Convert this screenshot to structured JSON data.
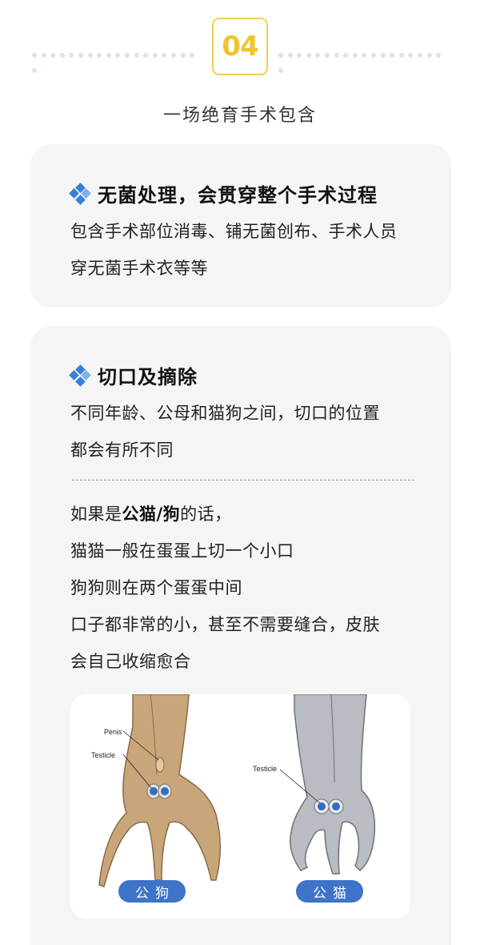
{
  "badge": {
    "number": "04"
  },
  "section_title": "一场绝育手术包含",
  "card1": {
    "heading": "无菌处理，会贯穿整个手术过程",
    "lines": [
      "包含手术部位消毒、铺无菌创布、手术人员",
      "穿无菌手术衣等等"
    ]
  },
  "card2": {
    "heading": "切口及摘除",
    "intro_lines": [
      "不同年龄、公母和猫狗之间，切口的位置",
      "都会有所不同"
    ],
    "male_prefix": "如果是",
    "male_bold": "公猫/狗",
    "male_suffix": "的话，",
    "detail_lines": [
      "猫猫一般在蛋蛋上切一个小口",
      "狗狗则在两个蛋蛋中间",
      "口子都非常的小，甚至不需要缝合，皮肤",
      "会自己收缩愈合"
    ]
  },
  "illustration": {
    "dog": {
      "label_penis": "Penis",
      "label_testicle": "Testicle",
      "pill": "公狗"
    },
    "cat": {
      "label_testicle": "Testicle",
      "pill": "公猫"
    }
  },
  "colors": {
    "accent_yellow": "#f0c330",
    "accent_blue": "#3a7fd6",
    "pill_blue": "#3d74c7",
    "card_bg": "#f5f5f5"
  },
  "icons": [
    "blue-diamond-cross-icon"
  ]
}
